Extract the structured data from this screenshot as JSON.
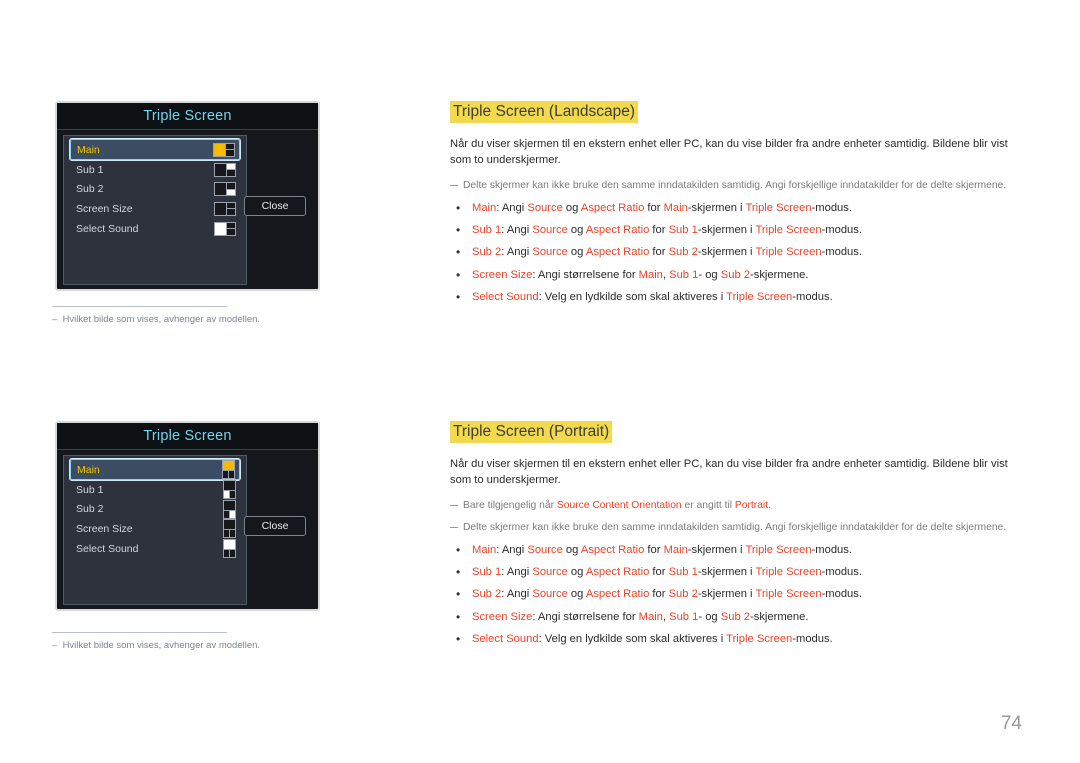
{
  "page": {
    "number": "74"
  },
  "dialogs": [
    {
      "id": "landscape",
      "title": "Triple Screen",
      "close_label": "Close",
      "orientation": "landscape",
      "rows": [
        {
          "label": "Main",
          "selected": true,
          "icon": "layout-main-highlighted-icon",
          "cells": [
            "yellow",
            "dark",
            "dark"
          ]
        },
        {
          "label": "Sub 1",
          "selected": false,
          "icon": "layout-sub1-highlighted-icon",
          "cells": [
            "dark",
            "white",
            "dark"
          ]
        },
        {
          "label": "Sub 2",
          "selected": false,
          "icon": "layout-sub2-highlighted-icon",
          "cells": [
            "dark",
            "dark",
            "white"
          ]
        },
        {
          "label": "Screen Size",
          "selected": false,
          "icon": "layout-screen-size-icon",
          "cells": [
            "dark",
            "dark",
            "dark"
          ]
        },
        {
          "label": "Select Sound",
          "selected": false,
          "icon": "layout-select-sound-icon",
          "cells": [
            "white",
            "dark",
            "dark"
          ]
        }
      ],
      "note": {
        "text": "Hvilket bilde som vises, avhenger av modellen."
      }
    },
    {
      "id": "portrait",
      "title": "Triple Screen",
      "close_label": "Close",
      "orientation": "portrait",
      "rows": [
        {
          "label": "Main",
          "selected": true,
          "icon": "layout-main-highlighted-icon",
          "cells": [
            "yellow",
            "dark",
            "dark"
          ]
        },
        {
          "label": "Sub 1",
          "selected": false,
          "icon": "layout-sub1-highlighted-icon",
          "cells": [
            "dark",
            "white",
            "dark"
          ]
        },
        {
          "label": "Sub 2",
          "selected": false,
          "icon": "layout-sub2-highlighted-icon",
          "cells": [
            "dark",
            "dark",
            "white"
          ]
        },
        {
          "label": "Screen Size",
          "selected": false,
          "icon": "layout-screen-size-icon",
          "cells": [
            "dark",
            "dark",
            "dark"
          ]
        },
        {
          "label": "Select Sound",
          "selected": false,
          "icon": "layout-select-sound-icon",
          "cells": [
            "white",
            "dark",
            "dark"
          ]
        }
      ],
      "note": {
        "text": "Hvilket bilde som vises, avhenger av modellen."
      }
    }
  ],
  "sections": [
    {
      "id": "landscape",
      "heading": "Triple Screen (Landscape)",
      "intro": "Når du viser skjermen til en ekstern enhet eller PC, kan du vise bilder fra andre enheter samtidig. Bildene blir vist som to underskjermer.",
      "notes": [
        "Delte skjermer kan ikke bruke den samme inndatakilden samtidig. Angi forskjellige inndatakilder for de delte skjermene."
      ]
    },
    {
      "id": "portrait",
      "heading": "Triple Screen (Portrait)",
      "intro": "Når du viser skjermen til en ekstern enhet eller PC, kan du vise bilder fra andre enheter samtidig. Bildene blir vist som to underskjermer.",
      "notes": [
        "Bare tilgjengelig når Source Content Orientation er angitt til Portrait.",
        "Delte skjermer kan ikke bruke den samme inndatakilden samtidig. Angi forskjellige inndatakilder for de delte skjermene."
      ],
      "note_keywords": [
        "Source Content Orientation",
        "Portrait"
      ]
    }
  ],
  "bullets": [
    {
      "term": "Main",
      "parts": [
        "",
        ": Angi ",
        "Source",
        " og ",
        "Aspect Ratio",
        " for ",
        "Main",
        "-skjermen i ",
        "Triple Screen",
        "-modus."
      ]
    },
    {
      "term": "Sub 1",
      "parts": [
        "",
        ": Angi ",
        "Source",
        " og ",
        "Aspect Ratio",
        " for ",
        "Sub 1",
        "-skjermen i ",
        "Triple Screen",
        "-modus."
      ]
    },
    {
      "term": "Sub 2",
      "parts": [
        "",
        ": Angi ",
        "Source",
        " og ",
        "Aspect Ratio",
        " for ",
        "Sub 2",
        "-skjermen i ",
        "Triple Screen",
        "-modus."
      ]
    },
    {
      "term": "Screen Size",
      "parts": [
        "",
        ": Angi størrelsene for ",
        "Main",
        ", ",
        "Sub 1",
        "- og ",
        "Sub 2",
        "-skjermene."
      ]
    },
    {
      "term": "Select Sound",
      "parts": [
        "",
        ": Velg en lydkilde som skal aktiveres i ",
        "Triple Screen",
        "-modus."
      ]
    }
  ],
  "labels": {
    "main": "Main",
    "sub1": "Sub 1",
    "sub2": "Sub 2",
    "screen_size": "Screen Size",
    "select_sound": "Select Sound",
    "source": "Source",
    "aspect_ratio": "Aspect Ratio",
    "triple_screen": "Triple Screen",
    "source_content_orientation": "Source Content Orientation",
    "portrait": "Portrait"
  },
  "bullet_text": {
    "angi_prefix": ": Angi ",
    "og": " og ",
    "for": " for ",
    "skjermen_i": "-skjermen i ",
    "modus": "-modus.",
    "screen_size_mid": ": Angi størrelsene for ",
    "comma": ", ",
    "dash_og": "- og ",
    "skjermene": "-skjermene.",
    "select_sound_mid": ": Velg en lydkilde som skal aktiveres i "
  },
  "note_text": {
    "portrait_note_a": "Bare tilgjengelig når ",
    "portrait_note_b": " er angitt til ",
    "portrait_note_c": "."
  }
}
